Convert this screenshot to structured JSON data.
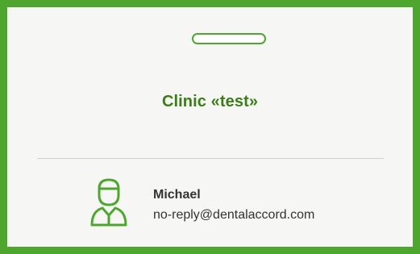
{
  "badge": {
    "clinic_title": "Clinic «test»",
    "user": {
      "name": "Michael",
      "email": "no-reply@dentalaccord.com"
    }
  },
  "icons": {
    "slot": "lanyard-slot",
    "user": "doctor-user-icon"
  },
  "colors": {
    "accent": "#4ea62f",
    "title": "#3a7d17",
    "text": "#333333",
    "background": "#f6f7f5"
  }
}
